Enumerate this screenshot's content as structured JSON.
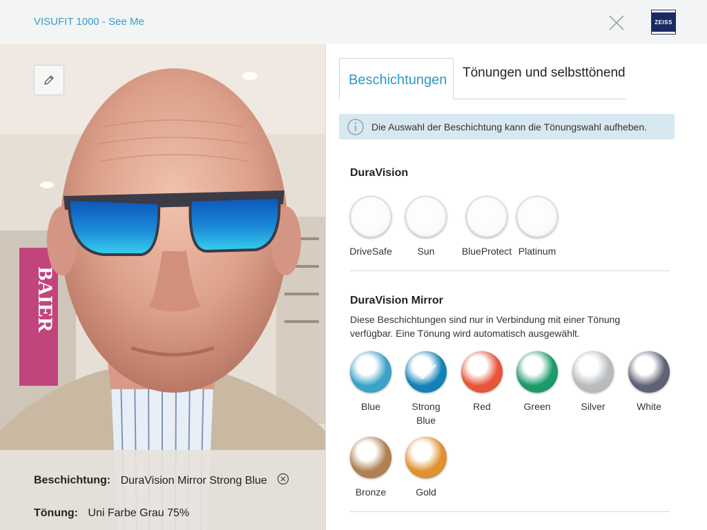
{
  "header": {
    "app_title": "VISUFIT 1000 - See Me",
    "logo_text": "ZEISS",
    "close_icon": "close-icon"
  },
  "photo": {
    "edit_icon": "pencil-icon",
    "sign_text": "BAIER"
  },
  "summary": {
    "coating_label": "Beschichtung:",
    "coating_value": "DuraVision Mirror Strong Blue",
    "tint_label": "Tönung:",
    "tint_value": "Uni Farbe Grau 75%"
  },
  "tabs": [
    {
      "label": "Beschichtungen",
      "active": true
    },
    {
      "label": "Tönungen und selbsttönend",
      "active": false
    }
  ],
  "info": {
    "icon": "info-icon",
    "text": "Die Auswahl der Beschichtung kann die Tönungswahl aufheben."
  },
  "duravision": {
    "title": "DuraVision",
    "options": [
      {
        "label": "DriveSafe"
      },
      {
        "label": "Sun"
      },
      {
        "label": "BlueProtect"
      },
      {
        "label": "Platinum"
      }
    ]
  },
  "mirror": {
    "title": "DuraVision Mirror",
    "description": "Diese Beschichtungen sind nur in Verbindung mit einer Tönung verfügbar. Eine Tönung wird automatisch ausgewählt.",
    "options": [
      {
        "label": "Blue",
        "color": "#3aa3c7",
        "selected": false
      },
      {
        "label": "Strong Blue",
        "color": "#1582b7",
        "selected": true
      },
      {
        "label": "Red",
        "color": "#e8563a",
        "selected": false
      },
      {
        "label": "Green",
        "color": "#1d9a6a",
        "selected": false
      },
      {
        "label": "Silver",
        "color": "#b9bcbf",
        "selected": false
      },
      {
        "label": "White",
        "color": "#5f6274",
        "selected": false
      },
      {
        "label": "Bronze",
        "color": "#b08052",
        "selected": false
      },
      {
        "label": "Gold",
        "color": "#e0922f",
        "selected": false
      }
    ]
  },
  "colors": {
    "accent": "#2b98c8",
    "info_bg": "#d8e8f0"
  }
}
